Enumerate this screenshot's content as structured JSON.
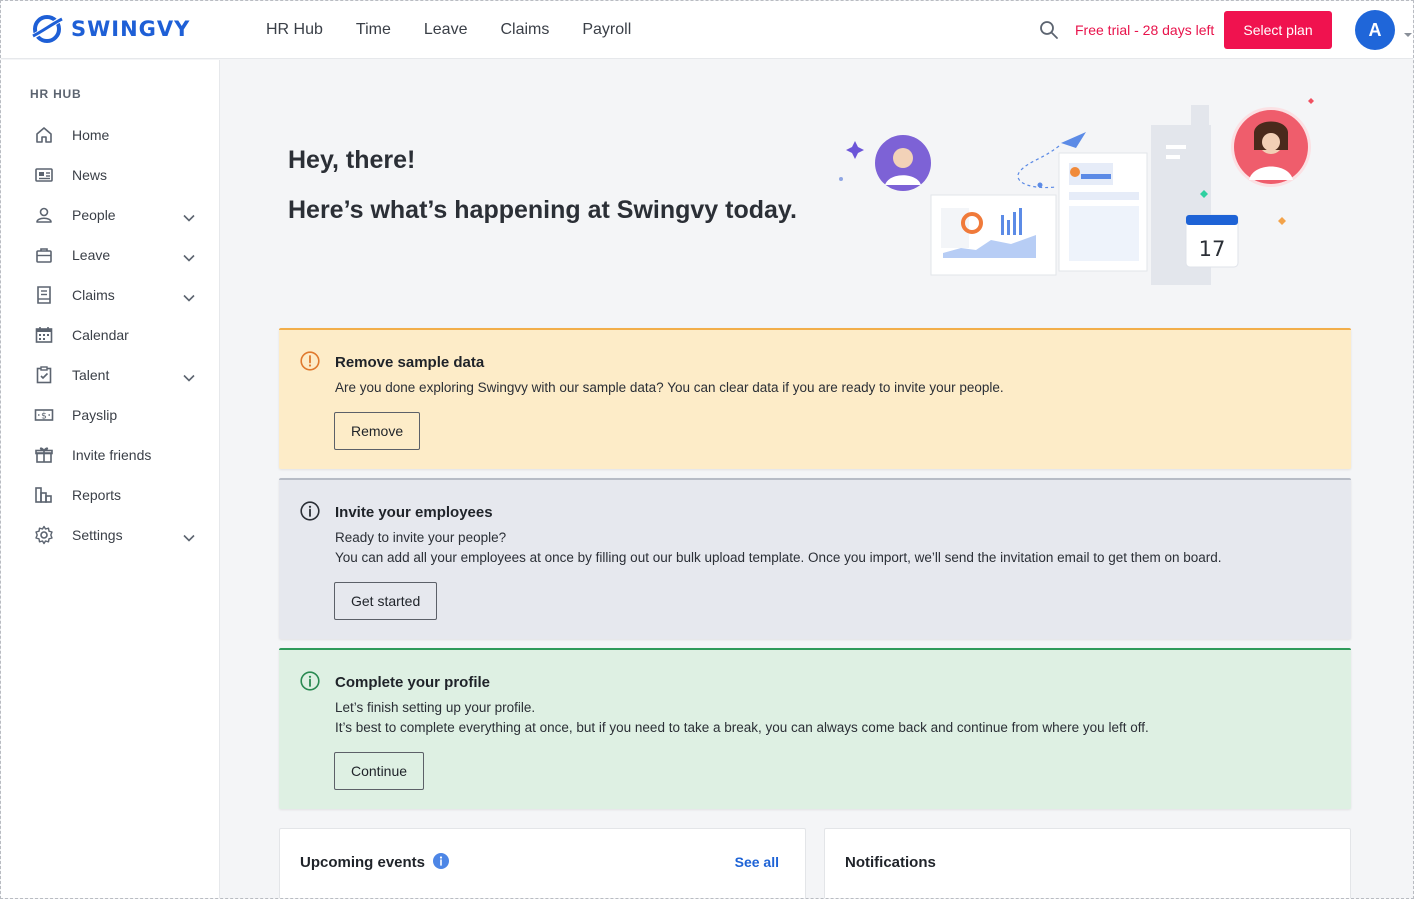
{
  "brand": {
    "name": "SWINGVY",
    "color": "#1e5fd6"
  },
  "topnav": {
    "items": [
      {
        "label": "HR Hub"
      },
      {
        "label": "Time"
      },
      {
        "label": "Leave"
      },
      {
        "label": "Claims"
      },
      {
        "label": "Payroll"
      }
    ],
    "trial_text": "Free trial - 28 days left",
    "select_plan_label": "Select plan",
    "avatar_initial": "A",
    "accent": "#f0124f"
  },
  "sidebar": {
    "heading": "HR HUB",
    "items": [
      {
        "label": "Home",
        "icon": "home-icon",
        "expandable": false
      },
      {
        "label": "News",
        "icon": "newspaper-icon",
        "expandable": false
      },
      {
        "label": "People",
        "icon": "person-icon",
        "expandable": true
      },
      {
        "label": "Leave",
        "icon": "briefcase-icon",
        "expandable": true
      },
      {
        "label": "Claims",
        "icon": "receipt-icon",
        "expandable": true
      },
      {
        "label": "Calendar",
        "icon": "calendar-icon",
        "expandable": false
      },
      {
        "label": "Talent",
        "icon": "clipboard-icon",
        "expandable": true
      },
      {
        "label": "Payslip",
        "icon": "money-icon",
        "expandable": false
      },
      {
        "label": "Invite friends",
        "icon": "gift-icon",
        "expandable": false
      },
      {
        "label": "Reports",
        "icon": "chart-icon",
        "expandable": false
      },
      {
        "label": "Settings",
        "icon": "gear-icon",
        "expandable": true
      }
    ]
  },
  "hero": {
    "greeting": "Hey, there!",
    "subtitle": "Here’s what’s happening at Swingvy today.",
    "calendar_day": "17"
  },
  "cards": {
    "sample": {
      "title": "Remove sample data",
      "text": "Are you done exploring Swingvy with our sample data? You can clear data if you are ready to invite your people.",
      "button": "Remove"
    },
    "invite": {
      "title": "Invite your employees",
      "text1": "Ready to invite your people?",
      "text2": "You can add all your employees at once by filling out our bulk upload template. Once you import, we’ll send the invitation email to get them on board.",
      "button": "Get started"
    },
    "profile": {
      "title": "Complete your profile",
      "text1": "Let’s finish setting up your profile.",
      "text2": "It’s best to complete everything at once, but if you need to take a break, you can always come back and continue from where you left off.",
      "button": "Continue"
    }
  },
  "panels": {
    "events_title": "Upcoming events",
    "see_all": "See all",
    "notifications_title": "Notifications"
  }
}
